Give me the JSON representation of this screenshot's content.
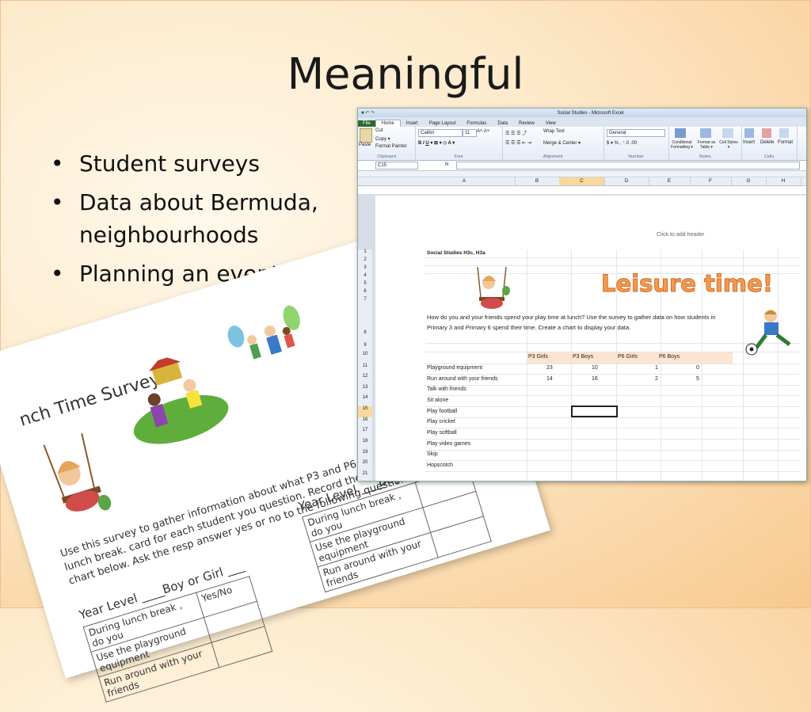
{
  "slide": {
    "title": "Meaningful",
    "bullets": [
      "Student surveys",
      "Data about Bermuda, neighbourhoods",
      "Planning an event"
    ]
  },
  "survey": {
    "title": "nch Time Survey",
    "instructions": "Use this survey to gather information about what P3 and P6 students do during lunch break. card for each student you question. Record the answers in the chart below. Ask the resp answer yes or no to the following questions.",
    "year_level": "Year Level ____",
    "boy_or_girl": "Boy or Girl ___",
    "year_level_right": "Year Level ____",
    "boy_right": "Boy o",
    "yes_no": "Yes/No",
    "rows": [
      "During lunch break , do you",
      "Use the playground equipment",
      "Run around with your friends"
    ],
    "rows_right": [
      "During lunch break , do you",
      "Use the playground equipment",
      "Run around with your friends"
    ]
  },
  "excel": {
    "window_title": "Social Studies - Microsoft Excel",
    "tabs": [
      "File",
      "Home",
      "Insert",
      "Page Layout",
      "Formulas",
      "Data",
      "Review",
      "View"
    ],
    "clipboard": {
      "paste": "Paste",
      "cut": "Cut",
      "copy": "Copy ▾",
      "format_painter": "Format Painter",
      "label": "Clipboard"
    },
    "font": {
      "name": "Calibri",
      "size": "11",
      "label": "Font"
    },
    "alignment": {
      "wrap": "Wrap Text",
      "merge": "Merge & Center ▾",
      "label": "Alignment"
    },
    "number": {
      "format": "General",
      "label": "Number"
    },
    "styles": {
      "conditional": "Conditional Formatting ▾",
      "format_table": "Format as Table ▾",
      "cell_styles": "Cell Styles ▾",
      "label": "Styles"
    },
    "cells": {
      "insert": "Insert",
      "delete": "Delete",
      "format": "Format",
      "label": "Cells"
    },
    "name_box": "C15",
    "fx": "fx",
    "columns": [
      "A",
      "B",
      "C",
      "D",
      "E",
      "F",
      "G",
      "H"
    ],
    "header_hint": "Click to add header",
    "sheet_title": "Social Studies H3c, H3a",
    "banner": "Leisure time!",
    "prompt": "How do you and your friends spend your play time at lunch?   Use the survey to gather data on how students in Primary 3 and Primary 6 spend their time.  Create a chart to display your data.",
    "row_numbers": [
      "1",
      "2",
      "3",
      "4",
      "5",
      "6",
      "7",
      "8",
      "9",
      "10",
      "11",
      "12",
      "13",
      "14",
      "15",
      "16",
      "17",
      "18",
      "19",
      "20",
      "21"
    ],
    "table_headers": [
      "P3 Girls",
      "P3 Boys",
      "P6 Girls",
      "P6 Boys"
    ],
    "activities": [
      {
        "name": "Playground equipment",
        "values": [
          "23",
          "10",
          "1",
          "0"
        ]
      },
      {
        "name": "Run around with your friends",
        "values": [
          "14",
          "16",
          "2",
          "5"
        ]
      },
      {
        "name": "Talk with friends",
        "values": [
          "",
          "",
          "",
          ""
        ]
      },
      {
        "name": "Sit alone",
        "values": [
          "",
          "",
          "",
          ""
        ]
      },
      {
        "name": "Play football",
        "values": [
          "",
          "",
          "",
          ""
        ]
      },
      {
        "name": "Play cricket",
        "values": [
          "",
          "",
          "",
          ""
        ]
      },
      {
        "name": "Play softball",
        "values": [
          "",
          "",
          "",
          ""
        ]
      },
      {
        "name": "Play video games",
        "values": [
          "",
          "",
          "",
          ""
        ]
      },
      {
        "name": "Skip",
        "values": [
          "",
          "",
          "",
          ""
        ]
      },
      {
        "name": "Hopscotch",
        "values": [
          "",
          "",
          "",
          ""
        ]
      }
    ]
  }
}
